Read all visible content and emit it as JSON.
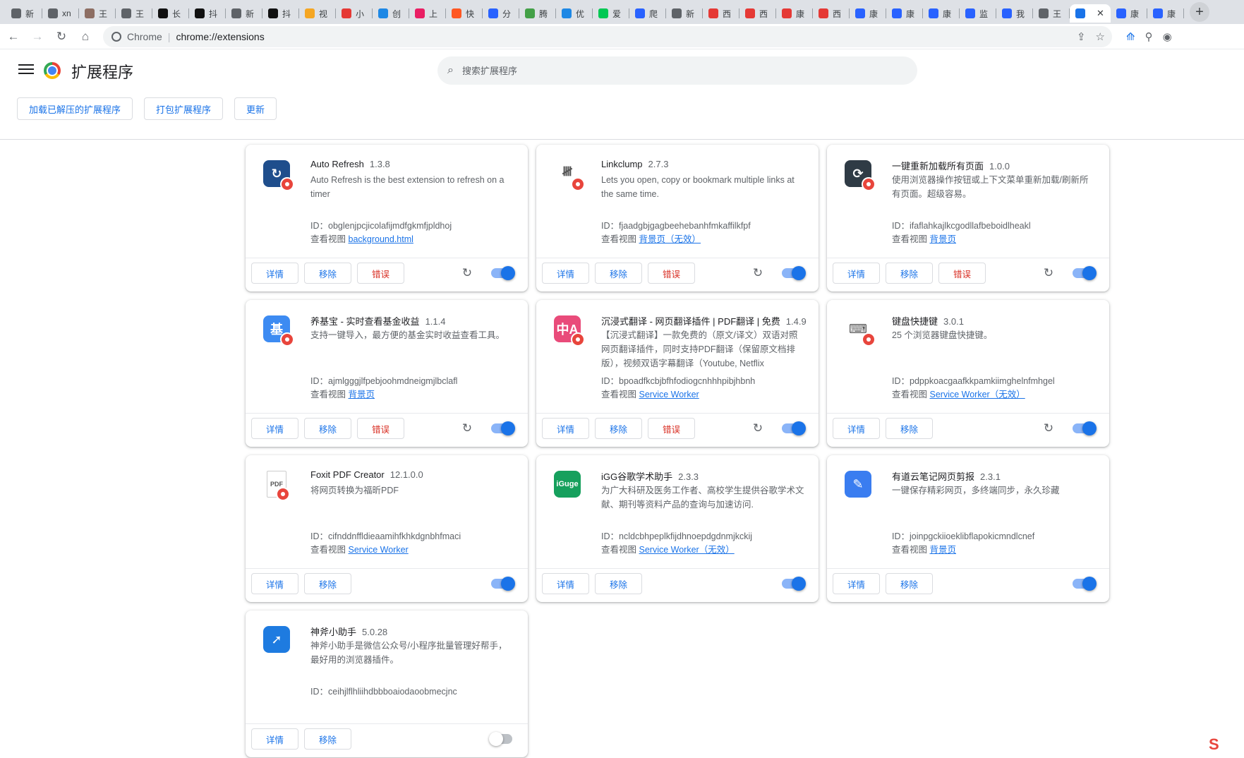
{
  "browser": {
    "tabs": [
      {
        "label": "新",
        "icon": "globe",
        "color": "#5f6368"
      },
      {
        "label": "xn",
        "icon": "globe",
        "color": "#5f6368"
      },
      {
        "label": "王",
        "icon": "avatar",
        "color": "#8d6e63"
      },
      {
        "label": "王",
        "icon": "globe",
        "color": "#5f6368"
      },
      {
        "label": "长",
        "icon": "tiktok",
        "color": "#111111"
      },
      {
        "label": "抖",
        "icon": "tiktok",
        "color": "#111111"
      },
      {
        "label": "新",
        "icon": "globe",
        "color": "#5f6368"
      },
      {
        "label": "抖",
        "icon": "tiktok",
        "color": "#111111"
      },
      {
        "label": "视",
        "icon": "w-logo",
        "color": "#f5a623"
      },
      {
        "label": "小",
        "icon": "red-logo",
        "color": "#e53935"
      },
      {
        "label": "创",
        "icon": "bili",
        "color": "#1e88e5"
      },
      {
        "label": "上",
        "icon": "pp",
        "color": "#e91e63"
      },
      {
        "label": "快",
        "icon": "kuai",
        "color": "#ff5722"
      },
      {
        "label": "分",
        "icon": "baidu",
        "color": "#2962ff"
      },
      {
        "label": "腾",
        "icon": "play",
        "color": "#43a047"
      },
      {
        "label": "优",
        "icon": "play",
        "color": "#1e88e5"
      },
      {
        "label": "爱",
        "icon": "iqiyi",
        "color": "#00c853"
      },
      {
        "label": "爬",
        "icon": "baidu",
        "color": "#2962ff"
      },
      {
        "label": "新",
        "icon": "globe",
        "color": "#5f6368"
      },
      {
        "label": "西",
        "icon": "red-circle",
        "color": "#e53935"
      },
      {
        "label": "西",
        "icon": "red-circle",
        "color": "#e53935"
      },
      {
        "label": "康",
        "icon": "red-circle",
        "color": "#e53935"
      },
      {
        "label": "西",
        "icon": "red-circle",
        "color": "#e53935"
      },
      {
        "label": "康",
        "icon": "baidu",
        "color": "#2962ff"
      },
      {
        "label": "康",
        "icon": "baidu",
        "color": "#2962ff"
      },
      {
        "label": "康",
        "icon": "baidu",
        "color": "#2962ff"
      },
      {
        "label": "监",
        "icon": "baidu",
        "color": "#2962ff"
      },
      {
        "label": "我",
        "icon": "baidu",
        "color": "#2962ff"
      },
      {
        "label": "王",
        "icon": "globe",
        "color": "#5f6368"
      },
      {
        "label": "",
        "icon": "puzzle",
        "color": "#1a73e8",
        "active": true
      },
      {
        "label": "康",
        "icon": "baidu",
        "color": "#2962ff"
      },
      {
        "label": "康",
        "icon": "baidu",
        "color": "#2962ff"
      }
    ],
    "site_label": "Chrome",
    "url": "chrome://extensions"
  },
  "header": {
    "title": "扩展程序",
    "search_placeholder": "搜索扩展程序",
    "buttons": [
      "加载已解压的扩展程序",
      "打包扩展程序",
      "更新"
    ]
  },
  "common": {
    "details": "详情",
    "remove": "移除",
    "errors": "错误",
    "id_prefix": "ID：",
    "views_prefix": "查看视图"
  },
  "extensions": [
    {
      "name": "Auto Refresh",
      "version": "1.3.8",
      "desc": "Auto Refresh is the best extension to refresh on a timer",
      "id": "obglenjpcjicolafijmdfgkmfjpldhoj",
      "view": "background.html",
      "has_errors": true,
      "reload": true,
      "enabled": true,
      "icon": "refresh-square-icon",
      "icon_color": "#1f4e8c",
      "icon_glyph": "↻"
    },
    {
      "name": "Linkclump",
      "version": "2.7.3",
      "desc": "Lets you open, copy or bookmark multiple links at the same time.",
      "id": "fjaadgbjgagbeehebanhfmkaffilkfpf",
      "view": "背景页（无效）",
      "has_errors": true,
      "reload": true,
      "enabled": true,
      "icon": "link-bundle-icon",
      "icon_color": "#ffffff",
      "icon_glyph": "𝍸"
    },
    {
      "name": "一键重新加载所有页面",
      "version": "1.0.0",
      "desc": "使用浏览器操作按钮或上下文菜单重新加载/刷新所有页面。超级容易。",
      "id": "ifaflahkajlkcgodllafbeboidlheakl",
      "view": "背景页",
      "has_errors": true,
      "reload": true,
      "enabled": true,
      "icon": "reload-circle-icon",
      "icon_color": "#2f3b45",
      "icon_glyph": "⟳"
    },
    {
      "name": "养基宝 - 实时查看基金收益",
      "version": "1.1.4",
      "desc": "支持一键导入，最方便的基金实时收益查看工具。",
      "id": "ajmlgggjlfpebjoohmdneigmjlbclafl",
      "view": "背景页",
      "has_errors": true,
      "reload": true,
      "enabled": true,
      "icon": "fund-icon",
      "icon_color": "#3d8bf2",
      "icon_glyph": "基"
    },
    {
      "name": "沉浸式翻译 - 网页翻译插件 | PDF翻译 | 免费",
      "version": "1.4.9",
      "desc": "【沉浸式翻译】一款免费的（原文/译文）双语对照网页翻译插件，同时支持PDF翻译（保留原文档排版），视频双语字幕翻译（Youtube, Netflix",
      "id": "bpoadfkcbjbfhfodiogcnhhhpibjhbnh",
      "view": "Service Worker",
      "has_errors": true,
      "reload": true,
      "enabled": true,
      "icon": "translate-icon",
      "icon_color": "#e94b7a",
      "icon_glyph": "中A"
    },
    {
      "name": "键盘快捷键",
      "version": "3.0.1",
      "desc": "25 个浏览器键盘快捷键。",
      "id": "pdppkoacgaafkkpamkiimghelnfmhgel",
      "view": "Service Worker（无效）",
      "has_errors": false,
      "reload": true,
      "enabled": true,
      "icon": "keyboard-icon",
      "icon_color": "#ffffff",
      "icon_glyph": "⌨"
    },
    {
      "name": "Foxit PDF Creator",
      "version": "12.1.0.0",
      "desc": "将网页转换为福昕PDF",
      "id": "cifnddnffldieaamihfkhkdgnbhfmaci",
      "view": "Service Worker",
      "has_errors": false,
      "reload": false,
      "enabled": true,
      "icon": "pdf-file-icon",
      "icon_color": "#ffffff",
      "icon_glyph": "PDF"
    },
    {
      "name": "iGG谷歌学术助手",
      "version": "2.3.3",
      "desc": "为广大科研及医务工作者、高校学生提供谷歌学术文献、期刊等资料产品的查询与加速访问.",
      "id": "ncldcbhpeplkfijdhnoepdgdnmjkckij",
      "view": "Service Worker（无效）",
      "has_errors": false,
      "reload": false,
      "enabled": true,
      "icon": "iguge-icon",
      "icon_color": "#16a05d",
      "icon_glyph": "iGuge"
    },
    {
      "name": "有道云笔记网页剪报",
      "version": "2.3.1",
      "desc": "一键保存精彩网页，多终端同步，永久珍藏",
      "id": "joinpgckiioeklibflapokicmndlcnef",
      "view": "背景页",
      "has_errors": false,
      "reload": false,
      "enabled": true,
      "icon": "youdao-note-icon",
      "icon_color": "#3a7df0",
      "icon_glyph": "✎"
    },
    {
      "name": "神斧小助手",
      "version": "5.0.28",
      "desc": "神斧小助手是微信公众号/小程序批量管理好帮手，最好用的浏览器插件。",
      "id": "ceihjlflhliihdbbboaiodaoobmecjnc",
      "view": "",
      "has_errors": false,
      "reload": false,
      "enabled": false,
      "icon": "shenfu-icon",
      "icon_color": "#1e7be0",
      "icon_glyph": "➚"
    }
  ]
}
